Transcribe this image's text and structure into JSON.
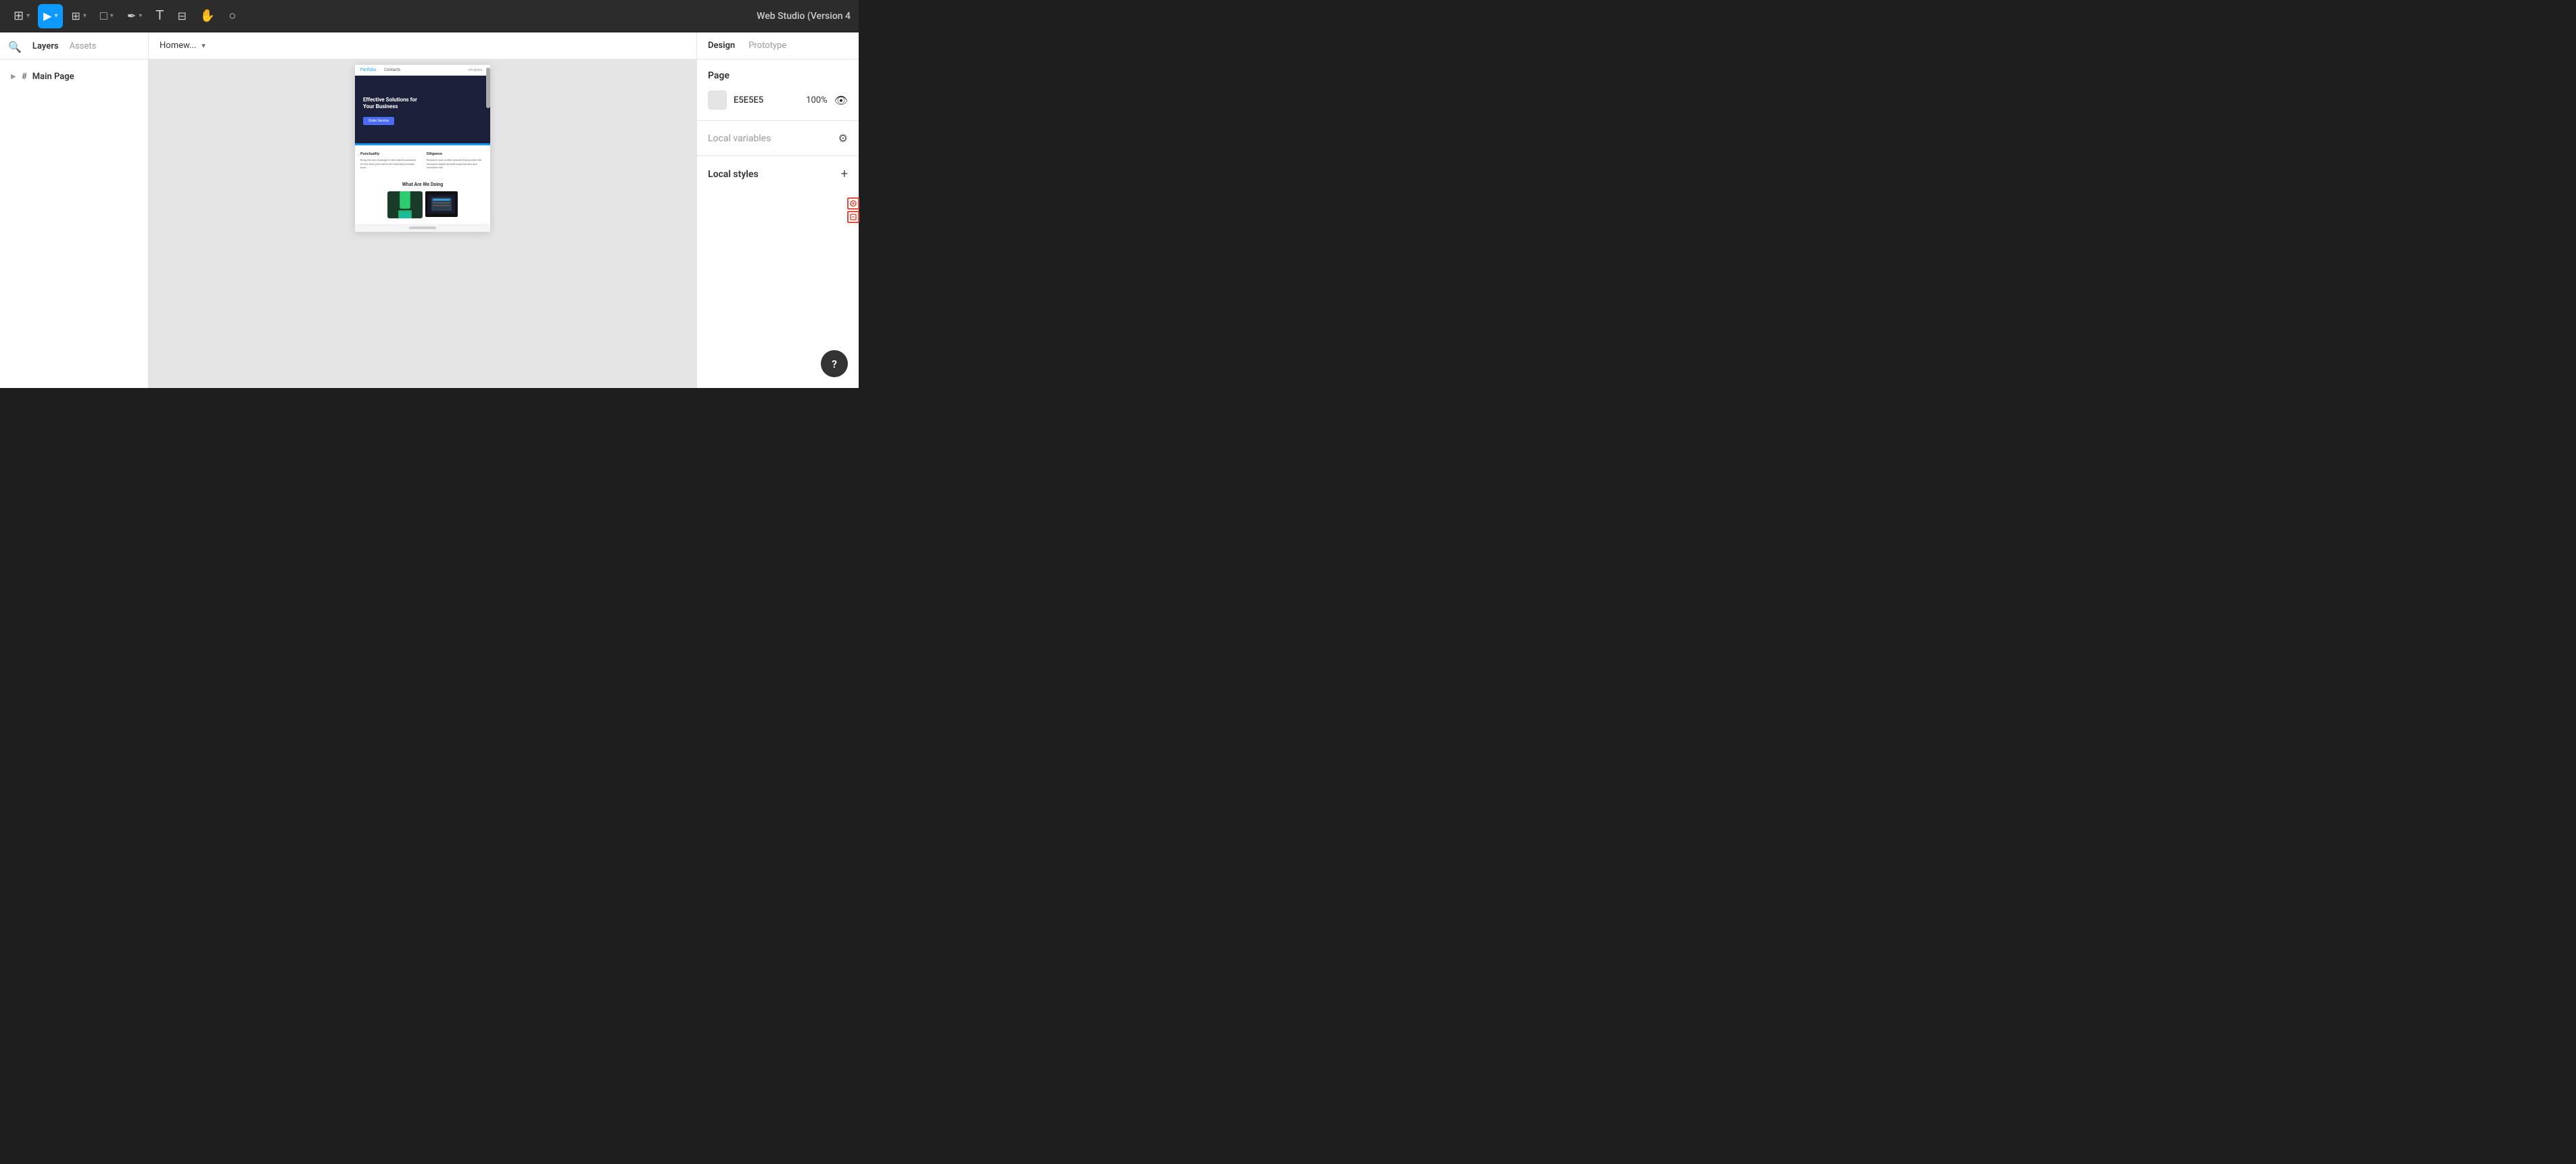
{
  "app": {
    "title": "Web Studio (Version 4"
  },
  "toolbar": {
    "tools": [
      {
        "id": "logo",
        "icon": "⊞",
        "label": "logo",
        "active": false,
        "hasChevron": true
      },
      {
        "id": "select",
        "icon": "▶",
        "label": "select-tool",
        "active": true,
        "hasChevron": true
      },
      {
        "id": "frame",
        "icon": "⊕",
        "label": "frame-tool",
        "active": false,
        "hasChevron": true
      },
      {
        "id": "shape",
        "icon": "□",
        "label": "shape-tool",
        "active": false,
        "hasChevron": true
      },
      {
        "id": "pen",
        "icon": "✒",
        "label": "pen-tool",
        "active": false,
        "hasChevron": true
      },
      {
        "id": "text",
        "icon": "T",
        "label": "text-tool",
        "active": false,
        "hasChevron": false
      },
      {
        "id": "components",
        "icon": "⊞",
        "label": "components-tool",
        "active": false,
        "hasChevron": false
      },
      {
        "id": "hand",
        "icon": "✋",
        "label": "hand-tool",
        "active": false,
        "hasChevron": false
      },
      {
        "id": "comment",
        "icon": "○",
        "label": "comment-tool",
        "active": false,
        "hasChevron": false
      }
    ]
  },
  "left_panel": {
    "search_icon": "🔍",
    "tabs": [
      {
        "id": "layers",
        "label": "Layers",
        "active": true
      },
      {
        "id": "assets",
        "label": "Assets",
        "active": false
      }
    ],
    "layers": [
      {
        "id": "main-page",
        "label": "Main Page",
        "icon": "#",
        "indent": 0
      }
    ]
  },
  "page_selector": {
    "label": "Homew...",
    "arrow": "▾"
  },
  "canvas": {
    "background_color": "#e5e5e5",
    "preview": {
      "nav_links": [
        "Portfolio",
        "Contacts"
      ],
      "nav_email": "info@dev...",
      "hero_title": "Effective Solutions for Your Business",
      "hero_button": "Order Service",
      "features": [
        {
          "title": "Punctuality",
          "text": "Bring the key message to the brand's audience for the best price within the shortest possible time."
        },
        {
          "title": "Diligence",
          "text": "Research and confirm brands that present the strongest digital growth opportunities and minimize risk."
        }
      ],
      "what_title": "What Are We Doing"
    }
  },
  "right_panel": {
    "tabs": [
      {
        "id": "design",
        "label": "Design",
        "active": true
      },
      {
        "id": "prototype",
        "label": "Prototype",
        "active": false
      }
    ],
    "page_section": {
      "title": "Page"
    },
    "color": {
      "swatch_color": "#E5E5E5",
      "hex": "E5E5E5",
      "opacity": "100%"
    },
    "local_variables": {
      "title": "Local variables"
    },
    "local_styles": {
      "title": "Local styles"
    },
    "help_button": "?"
  }
}
